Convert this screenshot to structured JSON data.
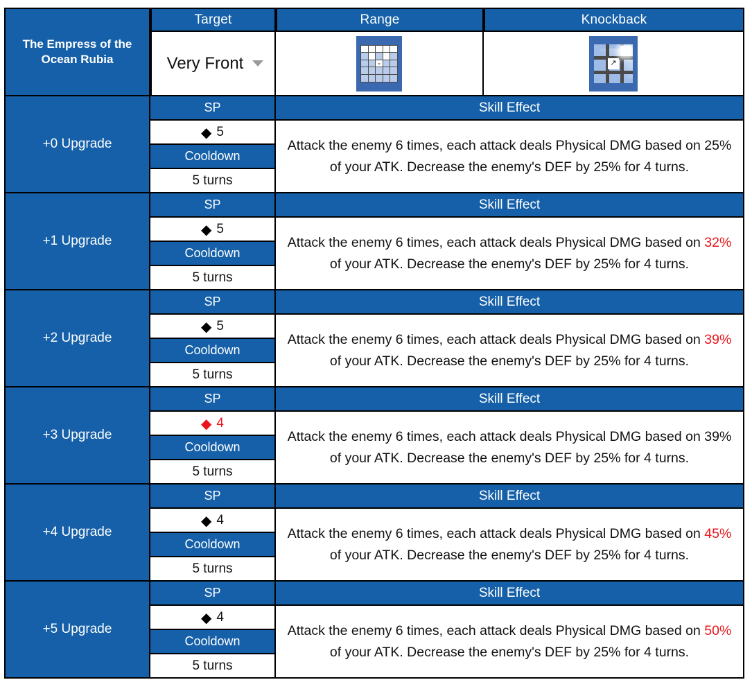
{
  "character": {
    "name": "The Empress of the Ocean Rubia"
  },
  "columns": {
    "target": "Target",
    "range": "Range",
    "knockback": "Knockback"
  },
  "target": {
    "value": "Very Front",
    "caret_icon": "chevron-down-icon"
  },
  "range_icon": {
    "name": "range-grid-icon",
    "grid_size": "5x5",
    "highlighted_cells": [
      0,
      1,
      2,
      3,
      4,
      6,
      8
    ],
    "caster_cell": 12,
    "caster_marker": "⌄"
  },
  "knockback_icon": {
    "name": "knockback-grid-icon",
    "grid_size": "3x3",
    "arrow": "↗",
    "direction": "up-right"
  },
  "labels": {
    "sp": "SP",
    "cooldown": "Cooldown",
    "skill_effect": "Skill Effect"
  },
  "colors": {
    "header_blue": "#1560a8",
    "accent_red": "#e8161c",
    "text_black": "#111111",
    "border": "#000000",
    "tile_bg": "#3a69b0"
  },
  "upgrades": [
    {
      "label": "+0 Upgrade",
      "sp": "5",
      "sp_color": "black",
      "cooldown": "5 turns",
      "effect_pre": "Attack the enemy 6 times, each attack deals Physical DMG based on ",
      "effect_pct": "25%",
      "pct_color": "black",
      "effect_post": " of your ATK. Decrease the enemy's DEF by 25% for 4 turns."
    },
    {
      "label": "+1 Upgrade",
      "sp": "5",
      "sp_color": "black",
      "cooldown": "5 turns",
      "effect_pre": "Attack the enemy 6 times, each attack deals Physical DMG based on ",
      "effect_pct": "32%",
      "pct_color": "red",
      "effect_post": " of your ATK. Decrease the enemy's DEF by 25% for 4 turns."
    },
    {
      "label": "+2 Upgrade",
      "sp": "5",
      "sp_color": "black",
      "cooldown": "5 turns",
      "effect_pre": "Attack the enemy 6 times, each attack deals Physical DMG based on ",
      "effect_pct": "39%",
      "pct_color": "red",
      "effect_post": " of your ATK. Decrease the enemy's DEF by 25% for 4 turns."
    },
    {
      "label": "+3 Upgrade",
      "sp": "4",
      "sp_color": "red",
      "cooldown": "5 turns",
      "effect_pre": "Attack the enemy 6 times, each attack deals Physical DMG based on ",
      "effect_pct": "39%",
      "pct_color": "black",
      "effect_post": " of your ATK. Decrease the enemy's DEF by 25% for 4 turns."
    },
    {
      "label": "+4 Upgrade",
      "sp": "4",
      "sp_color": "black",
      "cooldown": "5 turns",
      "effect_pre": "Attack the enemy 6 times, each attack deals Physical DMG based on ",
      "effect_pct": "45%",
      "pct_color": "red",
      "effect_post": " of your ATK. Decrease the enemy's DEF by 25% for 4 turns."
    },
    {
      "label": "+5 Upgrade",
      "sp": "4",
      "sp_color": "black",
      "cooldown": "5 turns",
      "effect_pre": "Attack the enemy 6 times, each attack deals Physical DMG based on ",
      "effect_pct": "50%",
      "pct_color": "red",
      "effect_post": " of your ATK. Decrease the enemy's DEF by 25% for 4 turns."
    }
  ]
}
